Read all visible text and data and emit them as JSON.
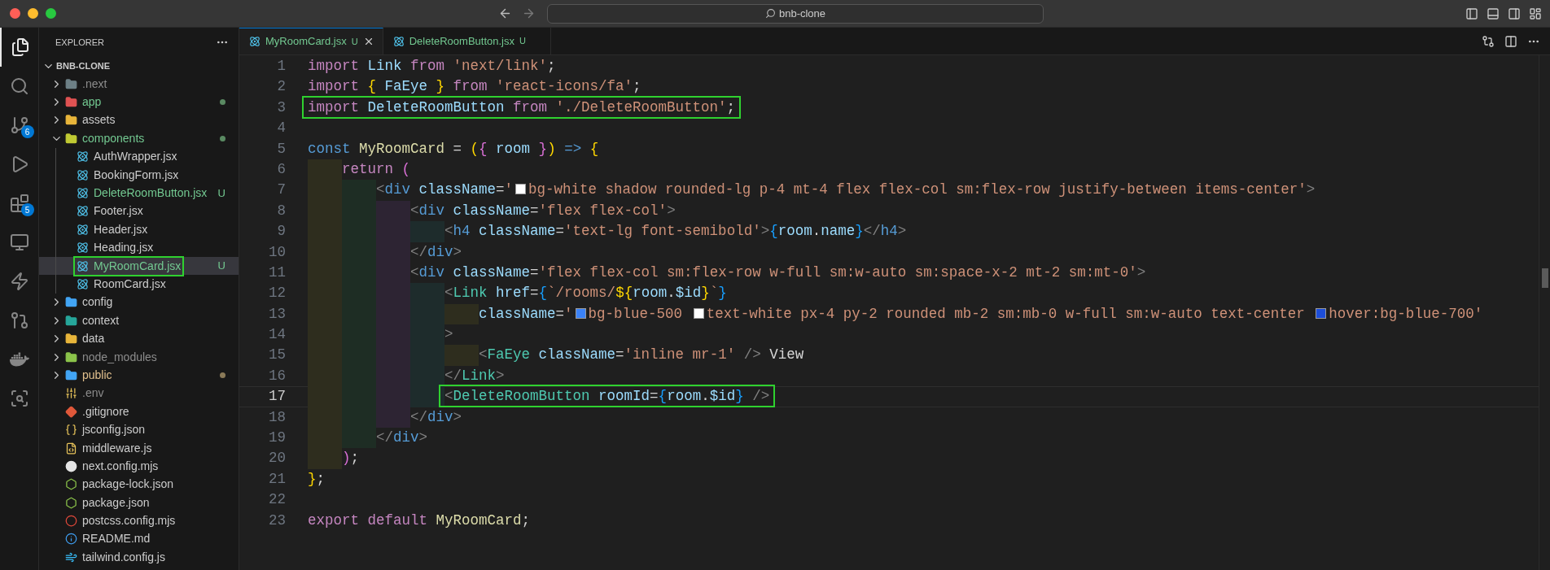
{
  "window": {
    "search": "bnb-clone"
  },
  "activity_bar": [
    {
      "kind": "files",
      "selected": true
    },
    {
      "kind": "search",
      "selected": false
    },
    {
      "kind": "source-control",
      "selected": false,
      "badge": "6"
    },
    {
      "kind": "run",
      "selected": false
    },
    {
      "kind": "extensions",
      "selected": false,
      "badge": "5"
    },
    {
      "kind": "remote",
      "selected": false
    },
    {
      "kind": "lightning",
      "selected": false
    },
    {
      "kind": "git-graph",
      "selected": false
    },
    {
      "kind": "docker",
      "selected": false
    },
    {
      "kind": "inspect",
      "selected": false
    }
  ],
  "explorer": {
    "title": "EXPLORER",
    "root": {
      "label": "BNB-CLONE",
      "expanded": true,
      "children": [
        {
          "label": ".next",
          "kind": "folder",
          "color": "#6d8086",
          "untracked": false,
          "modified": false,
          "ignored": true,
          "expanded": false,
          "selected": false
        },
        {
          "label": "app",
          "kind": "folder",
          "color": "#e05252",
          "untracked": true,
          "modified": false,
          "ignored": false,
          "dot": true,
          "expanded": false,
          "selected": false
        },
        {
          "label": "assets",
          "kind": "folder",
          "color": "#e8b53a",
          "untracked": false,
          "modified": false,
          "ignored": false,
          "expanded": false,
          "selected": false
        },
        {
          "label": "components",
          "kind": "folder",
          "color": "#c0ca33",
          "untracked": true,
          "modified": false,
          "ignored": false,
          "dot": true,
          "expanded": true,
          "selected": false,
          "children": [
            {
              "label": "AuthWrapper.jsx",
              "kind": "react",
              "untracked": false,
              "modified": false,
              "ignored": false,
              "selected": false
            },
            {
              "label": "BookingForm.jsx",
              "kind": "react",
              "untracked": false,
              "modified": false,
              "ignored": false,
              "selected": false
            },
            {
              "label": "DeleteRoomButton.jsx",
              "kind": "react",
              "untracked": true,
              "modified": false,
              "ignored": false,
              "badge": "U",
              "selected": false
            },
            {
              "label": "Footer.jsx",
              "kind": "react",
              "untracked": false,
              "modified": false,
              "ignored": false,
              "selected": false
            },
            {
              "label": "Header.jsx",
              "kind": "react",
              "untracked": false,
              "modified": false,
              "ignored": false,
              "selected": false
            },
            {
              "label": "Heading.jsx",
              "kind": "react",
              "untracked": false,
              "modified": false,
              "ignored": false,
              "selected": false
            },
            {
              "label": "MyRoomCard.jsx",
              "kind": "react",
              "untracked": true,
              "modified": false,
              "ignored": false,
              "badge": "U",
              "selected": true,
              "highlighted": true
            },
            {
              "label": "RoomCard.jsx",
              "kind": "react",
              "untracked": false,
              "modified": false,
              "ignored": false,
              "selected": false
            }
          ]
        },
        {
          "label": "config",
          "kind": "folder",
          "color": "#42a5f5",
          "untracked": false,
          "modified": false,
          "ignored": false,
          "expanded": false,
          "selected": false
        },
        {
          "label": "context",
          "kind": "folder",
          "color": "#26a69a",
          "untracked": false,
          "modified": false,
          "ignored": false,
          "expanded": false,
          "selected": false
        },
        {
          "label": "data",
          "kind": "folder",
          "color": "#e8b53a",
          "untracked": false,
          "modified": false,
          "ignored": false,
          "expanded": false,
          "selected": false
        },
        {
          "label": "node_modules",
          "kind": "folder",
          "color": "#8bc34a",
          "untracked": false,
          "modified": false,
          "ignored": true,
          "expanded": false,
          "selected": false
        },
        {
          "label": "public",
          "kind": "folder",
          "color": "#42a5f5",
          "untracked": false,
          "modified": true,
          "ignored": false,
          "dot": true,
          "expanded": false,
          "selected": false
        },
        {
          "label": ".env",
          "kind": "env",
          "untracked": false,
          "modified": false,
          "ignored": true,
          "selected": false
        },
        {
          "label": ".gitignore",
          "kind": "git",
          "untracked": false,
          "modified": false,
          "ignored": false,
          "selected": false
        },
        {
          "label": "jsconfig.json",
          "kind": "json",
          "untracked": false,
          "modified": false,
          "ignored": false,
          "selected": false
        },
        {
          "label": "middleware.js",
          "kind": "js",
          "untracked": false,
          "modified": false,
          "ignored": false,
          "selected": false
        },
        {
          "label": "next.config.mjs",
          "kind": "next",
          "untracked": false,
          "modified": false,
          "ignored": false,
          "selected": false
        },
        {
          "label": "package-lock.json",
          "kind": "npm",
          "untracked": false,
          "modified": false,
          "ignored": false,
          "selected": false
        },
        {
          "label": "package.json",
          "kind": "npm",
          "untracked": false,
          "modified": false,
          "ignored": false,
          "selected": false
        },
        {
          "label": "postcss.config.mjs",
          "kind": "postcss",
          "untracked": false,
          "modified": false,
          "ignored": false,
          "selected": false
        },
        {
          "label": "README.md",
          "kind": "info",
          "untracked": false,
          "modified": false,
          "ignored": false,
          "selected": false
        },
        {
          "label": "tailwind.config.js",
          "kind": "tailwind",
          "untracked": false,
          "modified": false,
          "ignored": false,
          "selected": false
        }
      ]
    }
  },
  "tabs": [
    {
      "label": "MyRoomCard.jsx",
      "badge": "U",
      "selected": true
    },
    {
      "label": "DeleteRoomButton.jsx",
      "badge": "U",
      "selected": false
    }
  ],
  "editor": {
    "lines": [
      {
        "number": "1",
        "tokens": [
          {
            "kind": "kw",
            "text": "import "
          },
          {
            "kind": "var",
            "text": "Link "
          },
          {
            "kind": "kw",
            "text": "from "
          },
          {
            "kind": "str",
            "text": "'next/link'"
          },
          {
            "kind": "punct",
            "text": ";"
          }
        ]
      },
      {
        "number": "2",
        "tokens": [
          {
            "kind": "kw",
            "text": "import "
          },
          {
            "kind": "br1",
            "text": "{ "
          },
          {
            "kind": "var",
            "text": "FaEye "
          },
          {
            "kind": "br1",
            "text": "} "
          },
          {
            "kind": "kw",
            "text": "from "
          },
          {
            "kind": "str",
            "text": "'react-icons/fa'"
          },
          {
            "kind": "punct",
            "text": ";"
          }
        ]
      },
      {
        "number": "3",
        "highlighted": true,
        "tokens": [
          {
            "kind": "kw",
            "text": "import "
          },
          {
            "kind": "var",
            "text": "DeleteRoomButton "
          },
          {
            "kind": "kw",
            "text": "from "
          },
          {
            "kind": "str",
            "text": "'./DeleteRoomButton'"
          },
          {
            "kind": "punct",
            "text": ";"
          }
        ]
      },
      {
        "number": "4"
      },
      {
        "number": "5",
        "tokens": [
          {
            "kind": "storage",
            "text": "const "
          },
          {
            "kind": "func",
            "text": "MyRoomCard "
          },
          {
            "kind": "punct",
            "text": "= "
          },
          {
            "kind": "br1",
            "text": "("
          },
          {
            "kind": "br2",
            "text": "{ "
          },
          {
            "kind": "var",
            "text": "room "
          },
          {
            "kind": "br2",
            "text": "}"
          },
          {
            "kind": "br1",
            "text": ")"
          },
          {
            "kind": "storage",
            "text": " => "
          },
          {
            "kind": "br1",
            "text": "{"
          }
        ]
      },
      {
        "number": "6",
        "tokens": [
          {
            "kind": "kw",
            "text": "    return "
          },
          {
            "kind": "br2",
            "text": "("
          }
        ]
      },
      {
        "number": "7",
        "tokens": [
          {
            "kind": "angle",
            "text": "        <"
          },
          {
            "kind": "tag",
            "text": "div "
          },
          {
            "kind": "attr",
            "text": "className"
          },
          {
            "kind": "punct",
            "text": "="
          },
          {
            "kind": "str",
            "text": "'"
          },
          {
            "kind": "swatch",
            "color": "#ffffff"
          },
          {
            "kind": "str",
            "text": "bg-white shadow rounded-lg p-4 mt-4 flex flex-col sm:flex-row justify-between items-center'"
          },
          {
            "kind": "angle",
            "text": ">"
          }
        ]
      },
      {
        "number": "8",
        "tokens": [
          {
            "kind": "angle",
            "text": "            <"
          },
          {
            "kind": "tag",
            "text": "div "
          },
          {
            "kind": "attr",
            "text": "className"
          },
          {
            "kind": "punct",
            "text": "="
          },
          {
            "kind": "str",
            "text": "'flex flex-col'"
          },
          {
            "kind": "angle",
            "text": ">"
          }
        ]
      },
      {
        "number": "9",
        "tokens": [
          {
            "kind": "angle",
            "text": "                <"
          },
          {
            "kind": "tag",
            "text": "h4 "
          },
          {
            "kind": "attr",
            "text": "className"
          },
          {
            "kind": "punct",
            "text": "="
          },
          {
            "kind": "str",
            "text": "'text-lg font-semibold'"
          },
          {
            "kind": "angle",
            "text": ">"
          },
          {
            "kind": "br3",
            "text": "{"
          },
          {
            "kind": "var",
            "text": "room"
          },
          {
            "kind": "punct",
            "text": "."
          },
          {
            "kind": "var",
            "text": "name"
          },
          {
            "kind": "br3",
            "text": "}"
          },
          {
            "kind": "angle",
            "text": "</"
          },
          {
            "kind": "tag",
            "text": "h4"
          },
          {
            "kind": "angle",
            "text": ">"
          }
        ]
      },
      {
        "number": "10",
        "tokens": [
          {
            "kind": "angle",
            "text": "            </"
          },
          {
            "kind": "tag",
            "text": "div"
          },
          {
            "kind": "angle",
            "text": ">"
          }
        ]
      },
      {
        "number": "11",
        "tokens": [
          {
            "kind": "angle",
            "text": "            <"
          },
          {
            "kind": "tag",
            "text": "div "
          },
          {
            "kind": "attr",
            "text": "className"
          },
          {
            "kind": "punct",
            "text": "="
          },
          {
            "kind": "str",
            "text": "'flex flex-col sm:flex-row w-full sm:w-auto sm:space-x-2 mt-2 sm:mt-0'"
          },
          {
            "kind": "angle",
            "text": ">"
          }
        ]
      },
      {
        "number": "12",
        "tokens": [
          {
            "kind": "angle",
            "text": "                <"
          },
          {
            "kind": "comp",
            "text": "Link "
          },
          {
            "kind": "attr",
            "text": "href"
          },
          {
            "kind": "punct",
            "text": "="
          },
          {
            "kind": "br3",
            "text": "{"
          },
          {
            "kind": "str",
            "text": "`/rooms/"
          },
          {
            "kind": "interp",
            "text": "${"
          },
          {
            "kind": "var",
            "text": "room"
          },
          {
            "kind": "punct",
            "text": "."
          },
          {
            "kind": "var",
            "text": "$id"
          },
          {
            "kind": "interp",
            "text": "}"
          },
          {
            "kind": "str",
            "text": "`"
          },
          {
            "kind": "br3",
            "text": "}"
          }
        ]
      },
      {
        "number": "13",
        "tokens": [
          {
            "kind": "attr",
            "text": "                    className"
          },
          {
            "kind": "punct",
            "text": "="
          },
          {
            "kind": "str",
            "text": "'"
          },
          {
            "kind": "swatch",
            "color": "#3b82f6"
          },
          {
            "kind": "str",
            "text": "bg-blue-500 "
          },
          {
            "kind": "swatch",
            "color": "#ffffff"
          },
          {
            "kind": "str",
            "text": "text-white px-4 py-2 rounded mb-2 sm:mb-0 w-full sm:w-auto text-center "
          },
          {
            "kind": "swatch",
            "color": "#1d4ed8"
          },
          {
            "kind": "str",
            "text": "hover:bg-blue-700'"
          }
        ]
      },
      {
        "number": "14",
        "tokens": [
          {
            "kind": "angle",
            "text": "                >"
          }
        ]
      },
      {
        "number": "15",
        "tokens": [
          {
            "kind": "angle",
            "text": "                    <"
          },
          {
            "kind": "comp",
            "text": "FaEye "
          },
          {
            "kind": "attr",
            "text": "className"
          },
          {
            "kind": "punct",
            "text": "="
          },
          {
            "kind": "str",
            "text": "'inline mr-1' "
          },
          {
            "kind": "angle",
            "text": "/>"
          },
          {
            "kind": "text",
            "text": " View"
          }
        ]
      },
      {
        "number": "16",
        "tokens": [
          {
            "kind": "angle",
            "text": "                </"
          },
          {
            "kind": "comp",
            "text": "Link"
          },
          {
            "kind": "angle",
            "text": ">"
          }
        ]
      },
      {
        "number": "17",
        "highlighted": true,
        "current": true,
        "tokens": [
          {
            "kind": "angle",
            "text": "                <"
          },
          {
            "kind": "comp",
            "text": "DeleteRoomButton "
          },
          {
            "kind": "attr",
            "text": "roomId"
          },
          {
            "kind": "punct",
            "text": "="
          },
          {
            "kind": "br3",
            "text": "{"
          },
          {
            "kind": "var",
            "text": "room"
          },
          {
            "kind": "punct",
            "text": "."
          },
          {
            "kind": "var",
            "text": "$id"
          },
          {
            "kind": "br3",
            "text": "}"
          },
          {
            "kind": "angle",
            "text": " />"
          }
        ]
      },
      {
        "number": "18",
        "tokens": [
          {
            "kind": "angle",
            "text": "            </"
          },
          {
            "kind": "tag",
            "text": "div"
          },
          {
            "kind": "angle",
            "text": ">"
          }
        ]
      },
      {
        "number": "19",
        "tokens": [
          {
            "kind": "angle",
            "text": "        </"
          },
          {
            "kind": "tag",
            "text": "div"
          },
          {
            "kind": "angle",
            "text": ">"
          }
        ]
      },
      {
        "number": "20",
        "tokens": [
          {
            "kind": "br2",
            "text": "    )"
          },
          {
            "kind": "punct",
            "text": ";"
          }
        ]
      },
      {
        "number": "21",
        "tokens": [
          {
            "kind": "br1",
            "text": "}"
          },
          {
            "kind": "punct",
            "text": ";"
          }
        ]
      },
      {
        "number": "22"
      },
      {
        "number": "23",
        "tokens": [
          {
            "kind": "kw",
            "text": "export "
          },
          {
            "kind": "kw",
            "text": "default "
          },
          {
            "kind": "func",
            "text": "MyRoomCard"
          },
          {
            "kind": "punct",
            "text": ";"
          }
        ]
      }
    ]
  }
}
